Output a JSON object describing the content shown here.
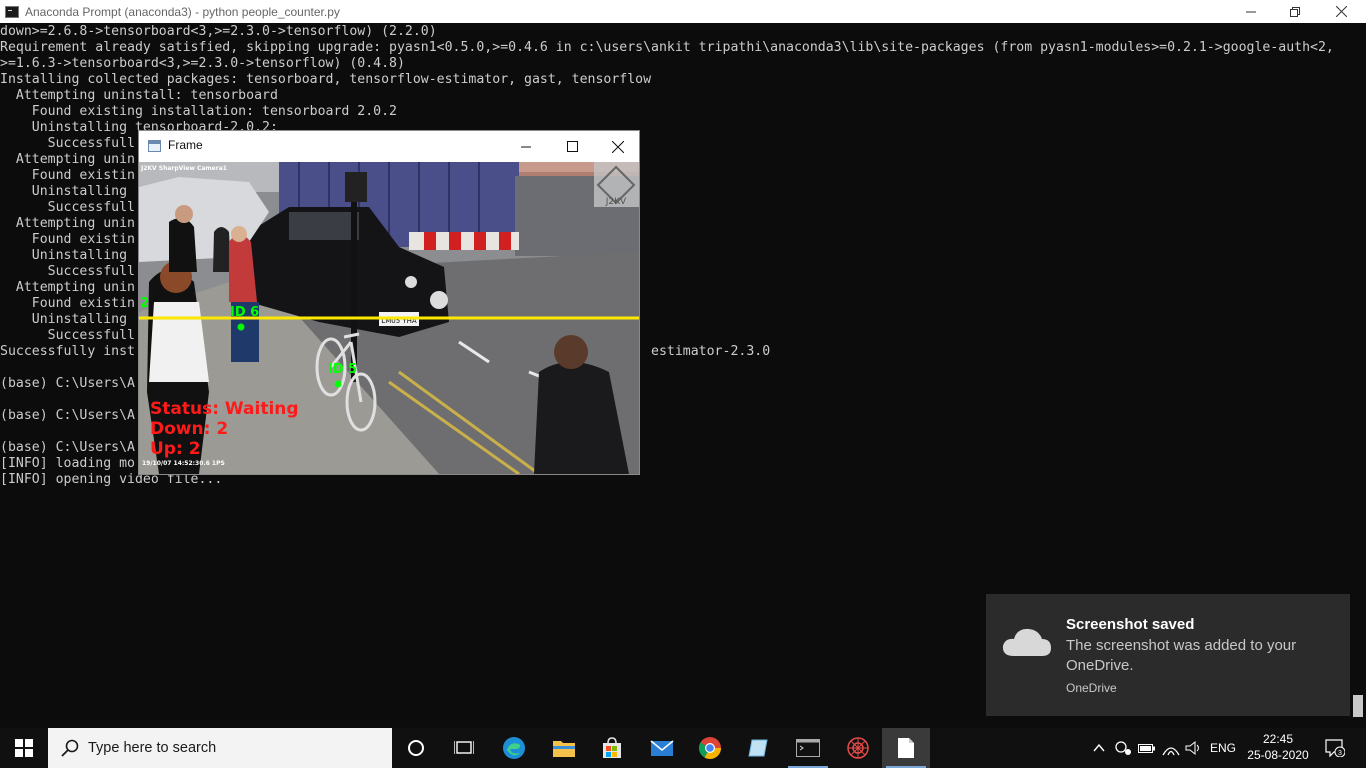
{
  "window": {
    "title": "Anaconda Prompt (anaconda3) - python  people_counter.py"
  },
  "console": {
    "lines": [
      "down>=2.6.8->tensorboard<3,>=2.3.0->tensorflow) (2.2.0)",
      "Requirement already satisfied, skipping upgrade: pyasn1<0.5.0,>=0.4.6 in c:\\users\\ankit tripathi\\anaconda3\\lib\\site-packages (from pyasn1-modules>=0.2.1->google-auth<2,",
      ">=1.6.3->tensorboard<3,>=2.3.0->tensorflow) (0.4.8)",
      "Installing collected packages: tensorboard, tensorflow-estimator, gast, tensorflow",
      "  Attempting uninstall: tensorboard",
      "    Found existing installation: tensorboard 2.0.2",
      "    Uninstalling tensorboard-2.0.2:",
      "      Successfull",
      "  Attempting unin",
      "    Found existin",
      "    Uninstalling",
      "      Successfull",
      "  Attempting unin",
      "    Found existin",
      "    Uninstalling",
      "      Successfull",
      "  Attempting unin",
      "    Found existin",
      "    Uninstalling",
      "      Successfull",
      "Successfully inst                                                                 estimator-2.3.0",
      "",
      "(base) C:\\Users\\A",
      "",
      "(base) C:\\Users\\A",
      "",
      "(base) C:\\Users\\A",
      "[INFO] loading mo",
      "[INFO] opening video file..."
    ]
  },
  "frame_window": {
    "title": "Frame",
    "camera_label": "J2KV SharpView Camera1",
    "plate": "LM05 YHA",
    "logo_text": "J2KV",
    "timestamp": "19/10/07 14:52:30.6 1PS",
    "line_count_label": "2",
    "track_a": "ID 6",
    "track_b": "ID 5",
    "status": "Status: Waiting",
    "down": "Down: 2",
    "up": "Up: 2",
    "colors": {
      "line": "#ffe800",
      "tracks": "#00ff00",
      "status": "#ff1a1a"
    }
  },
  "toast": {
    "title": "Screenshot saved",
    "body": "The screenshot was added to your OneDrive.",
    "source": "OneDrive"
  },
  "taskbar": {
    "search_placeholder": "Type here to search",
    "language": "ENG",
    "time": "22:45",
    "date": "25-08-2020",
    "notification_count": "3"
  }
}
